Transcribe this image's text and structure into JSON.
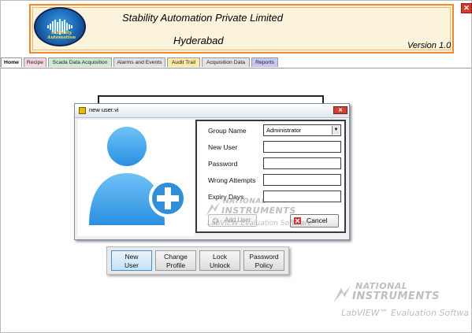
{
  "header": {
    "company": "Stability Automation Private Limited",
    "city": "Hyderabad",
    "version": "Version 1.0",
    "logo_text": "Stability Automation",
    "close_glyph": "✕"
  },
  "tabs": [
    {
      "label": "Home",
      "color": "#ffffff"
    },
    {
      "label": "Recipe",
      "color": "#f6d6e1"
    },
    {
      "label": "Scada Data Acquisition",
      "color": "#cfe8d3"
    },
    {
      "label": "Alarms and Events",
      "color": "#e2e2e2"
    },
    {
      "label": "Audit Trail",
      "color": "#fbeaa5"
    },
    {
      "label": "Acquisition Data",
      "color": "#e2e2e2"
    },
    {
      "label": "Reports",
      "color": "#c8c6f2"
    }
  ],
  "dialog": {
    "title": "new user.vi",
    "close_glyph": "✕",
    "fields": {
      "group_label": "Group Name",
      "group_value": "Administrator",
      "new_user_label": "New User",
      "password_label": "Password",
      "wrong_attempts_label": "Wrong Attempts",
      "expiry_days_label": "Expiry Days"
    },
    "add_user_label": "Add User",
    "cancel_label": "Cancel"
  },
  "actions": [
    {
      "line1": "New",
      "line2": "User"
    },
    {
      "line1": "Change",
      "line2": "Profile"
    },
    {
      "line1": "Lock",
      "line2": "Unlock"
    },
    {
      "line1": "Password",
      "line2": "Policy"
    }
  ],
  "watermark": {
    "brand_line1": "NATIONAL",
    "brand_line2": "INSTRUMENTS",
    "product": "LabVIEW",
    "edition": "Evaluation Software",
    "edition_cut": "Evaluation Softwa"
  },
  "colors": {
    "banner_border": "#f08a2a",
    "avatar": "#3aa3ec",
    "plus_badge": "#2f8fd8",
    "cancel_icon": "#d32f2f",
    "selected_button": "#c4e2f6"
  },
  "icons": {
    "window_close": "close-icon",
    "vi_icon": "labview-vi-icon",
    "avatar": "user-add-avatar",
    "dropdown": "chevron-down-icon",
    "add_user": "add-user-icon",
    "cancel": "cancel-x-icon"
  }
}
